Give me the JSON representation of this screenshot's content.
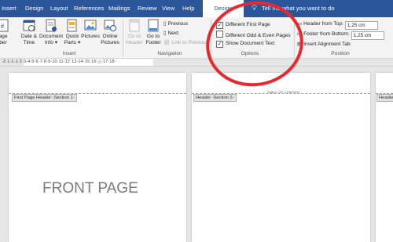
{
  "tabs": [
    {
      "label": "Insert",
      "active": false
    },
    {
      "label": "Design",
      "active": false
    },
    {
      "label": "Layout",
      "active": false
    },
    {
      "label": "References",
      "active": false
    },
    {
      "label": "Mailings",
      "active": false
    },
    {
      "label": "Review",
      "active": false
    },
    {
      "label": "View",
      "active": false
    },
    {
      "label": "Help",
      "active": false
    },
    {
      "label": "Design",
      "active": true
    }
  ],
  "tell_me": "Tell me what you want to do",
  "ribbon": {
    "page_number": {
      "line1": "age",
      "line2": "ber"
    },
    "date_time": {
      "line1": "Date &",
      "line2": "Time"
    },
    "document_info": {
      "line1": "Document",
      "line2": "Info"
    },
    "quick_parts": {
      "line1": "Quick",
      "line2": "Parts"
    },
    "pictures": {
      "line1": "Pictures",
      "line2": ""
    },
    "online_pictures": {
      "line1": "Online",
      "line2": "Pictures"
    },
    "go_to_header": {
      "line1": "Go to",
      "line2": "Header"
    },
    "go_to_footer": {
      "line1": "Go to",
      "line2": "Footer"
    },
    "previous": "Previous",
    "next": "Next",
    "link_to_previous": "Link to Previous",
    "different_first_page": "Different First Page",
    "different_odd_even": "Different Odd & Even Pages",
    "show_document_text": "Show Document Text",
    "header_from_top": "Header from Top:",
    "header_from_top_value": "1.25 cm",
    "footer_from_bottom": "Footer from Bottom:",
    "footer_from_bottom_value": "1.25 cm",
    "insert_alignment_tab": "Insert Alignment Tab",
    "groups": {
      "insert": "Insert",
      "navigation": "Navigation",
      "options": "Options",
      "position": "Position"
    }
  },
  "options_state": {
    "different_first_page": true,
    "different_odd_even": false,
    "show_document_text": true
  },
  "ruler_text": "·2·1·1·1·2·3·4·5·6·7·8·9·10·11·12·13·14·15·16·△·17·18·",
  "pages": {
    "page1_header_label": "First Page Header -Section 1-",
    "page2_header_label": "Header -Section 2-",
    "page3_header_label": "Header",
    "page2_toc": "TABLE OF CONTENT",
    "front_page_text": "FRONT PAGE"
  },
  "colors": {
    "ribbon_tab_bg": "#2b579a",
    "annotation": "#e8282d"
  }
}
